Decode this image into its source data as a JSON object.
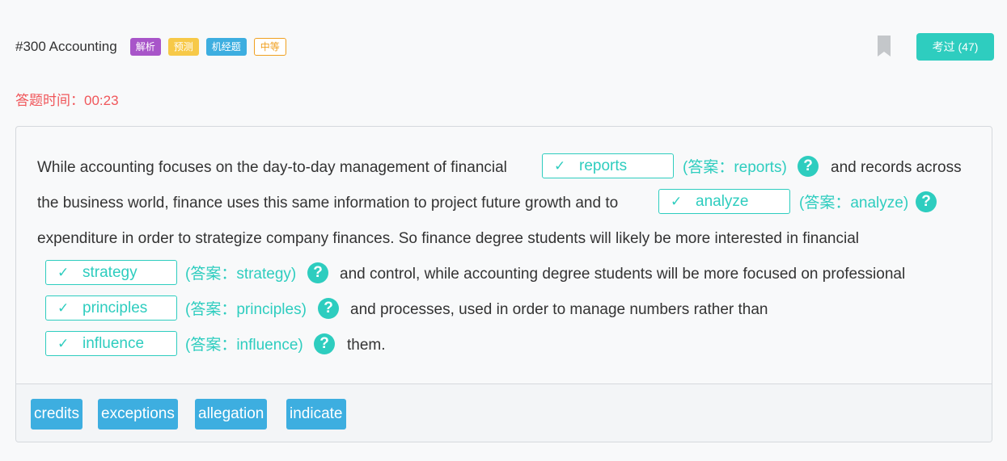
{
  "header": {
    "title": "#300 Accounting",
    "tags": [
      "解析",
      "预测",
      "机经题",
      "中等"
    ],
    "pass_button": "考过 (47)"
  },
  "timer": "答题时间：00:23",
  "passage": {
    "segments": [
      "While accounting focuses on the day-to-day management of financial",
      "and records across",
      "the business world, finance uses this same information to project future growth and to",
      "expenditure in order to strategize company finances. So finance degree students will likely be more interested in financial",
      "and control, while accounting degree students will be more focused on professional",
      "and processes, used in order to manage numbers rather than",
      "them."
    ],
    "blanks": [
      {
        "check": "✓",
        "value": "reports",
        "answer": "(答案：reports)"
      },
      {
        "check": "✓",
        "value": "analyze",
        "answer": "(答案：analyze)"
      },
      {
        "check": "✓",
        "value": "strategy",
        "answer": "(答案：strategy)"
      },
      {
        "check": "✓",
        "value": "principles",
        "answer": "(答案：principles)"
      },
      {
        "check": "✓",
        "value": "influence",
        "answer": "(答案：influence)"
      }
    ],
    "help_symbol": "?"
  },
  "word_bank": [
    "credits",
    "exceptions",
    "allegation",
    "indicate"
  ],
  "colors": {
    "accent": "#2ecdbf",
    "timer": "#f0565a",
    "chip": "#3daee0",
    "tag_purple": "#a855c9",
    "tag_yellow": "#f7c948",
    "tag_blue": "#3daee0",
    "tag_orange": "#f0a020"
  }
}
